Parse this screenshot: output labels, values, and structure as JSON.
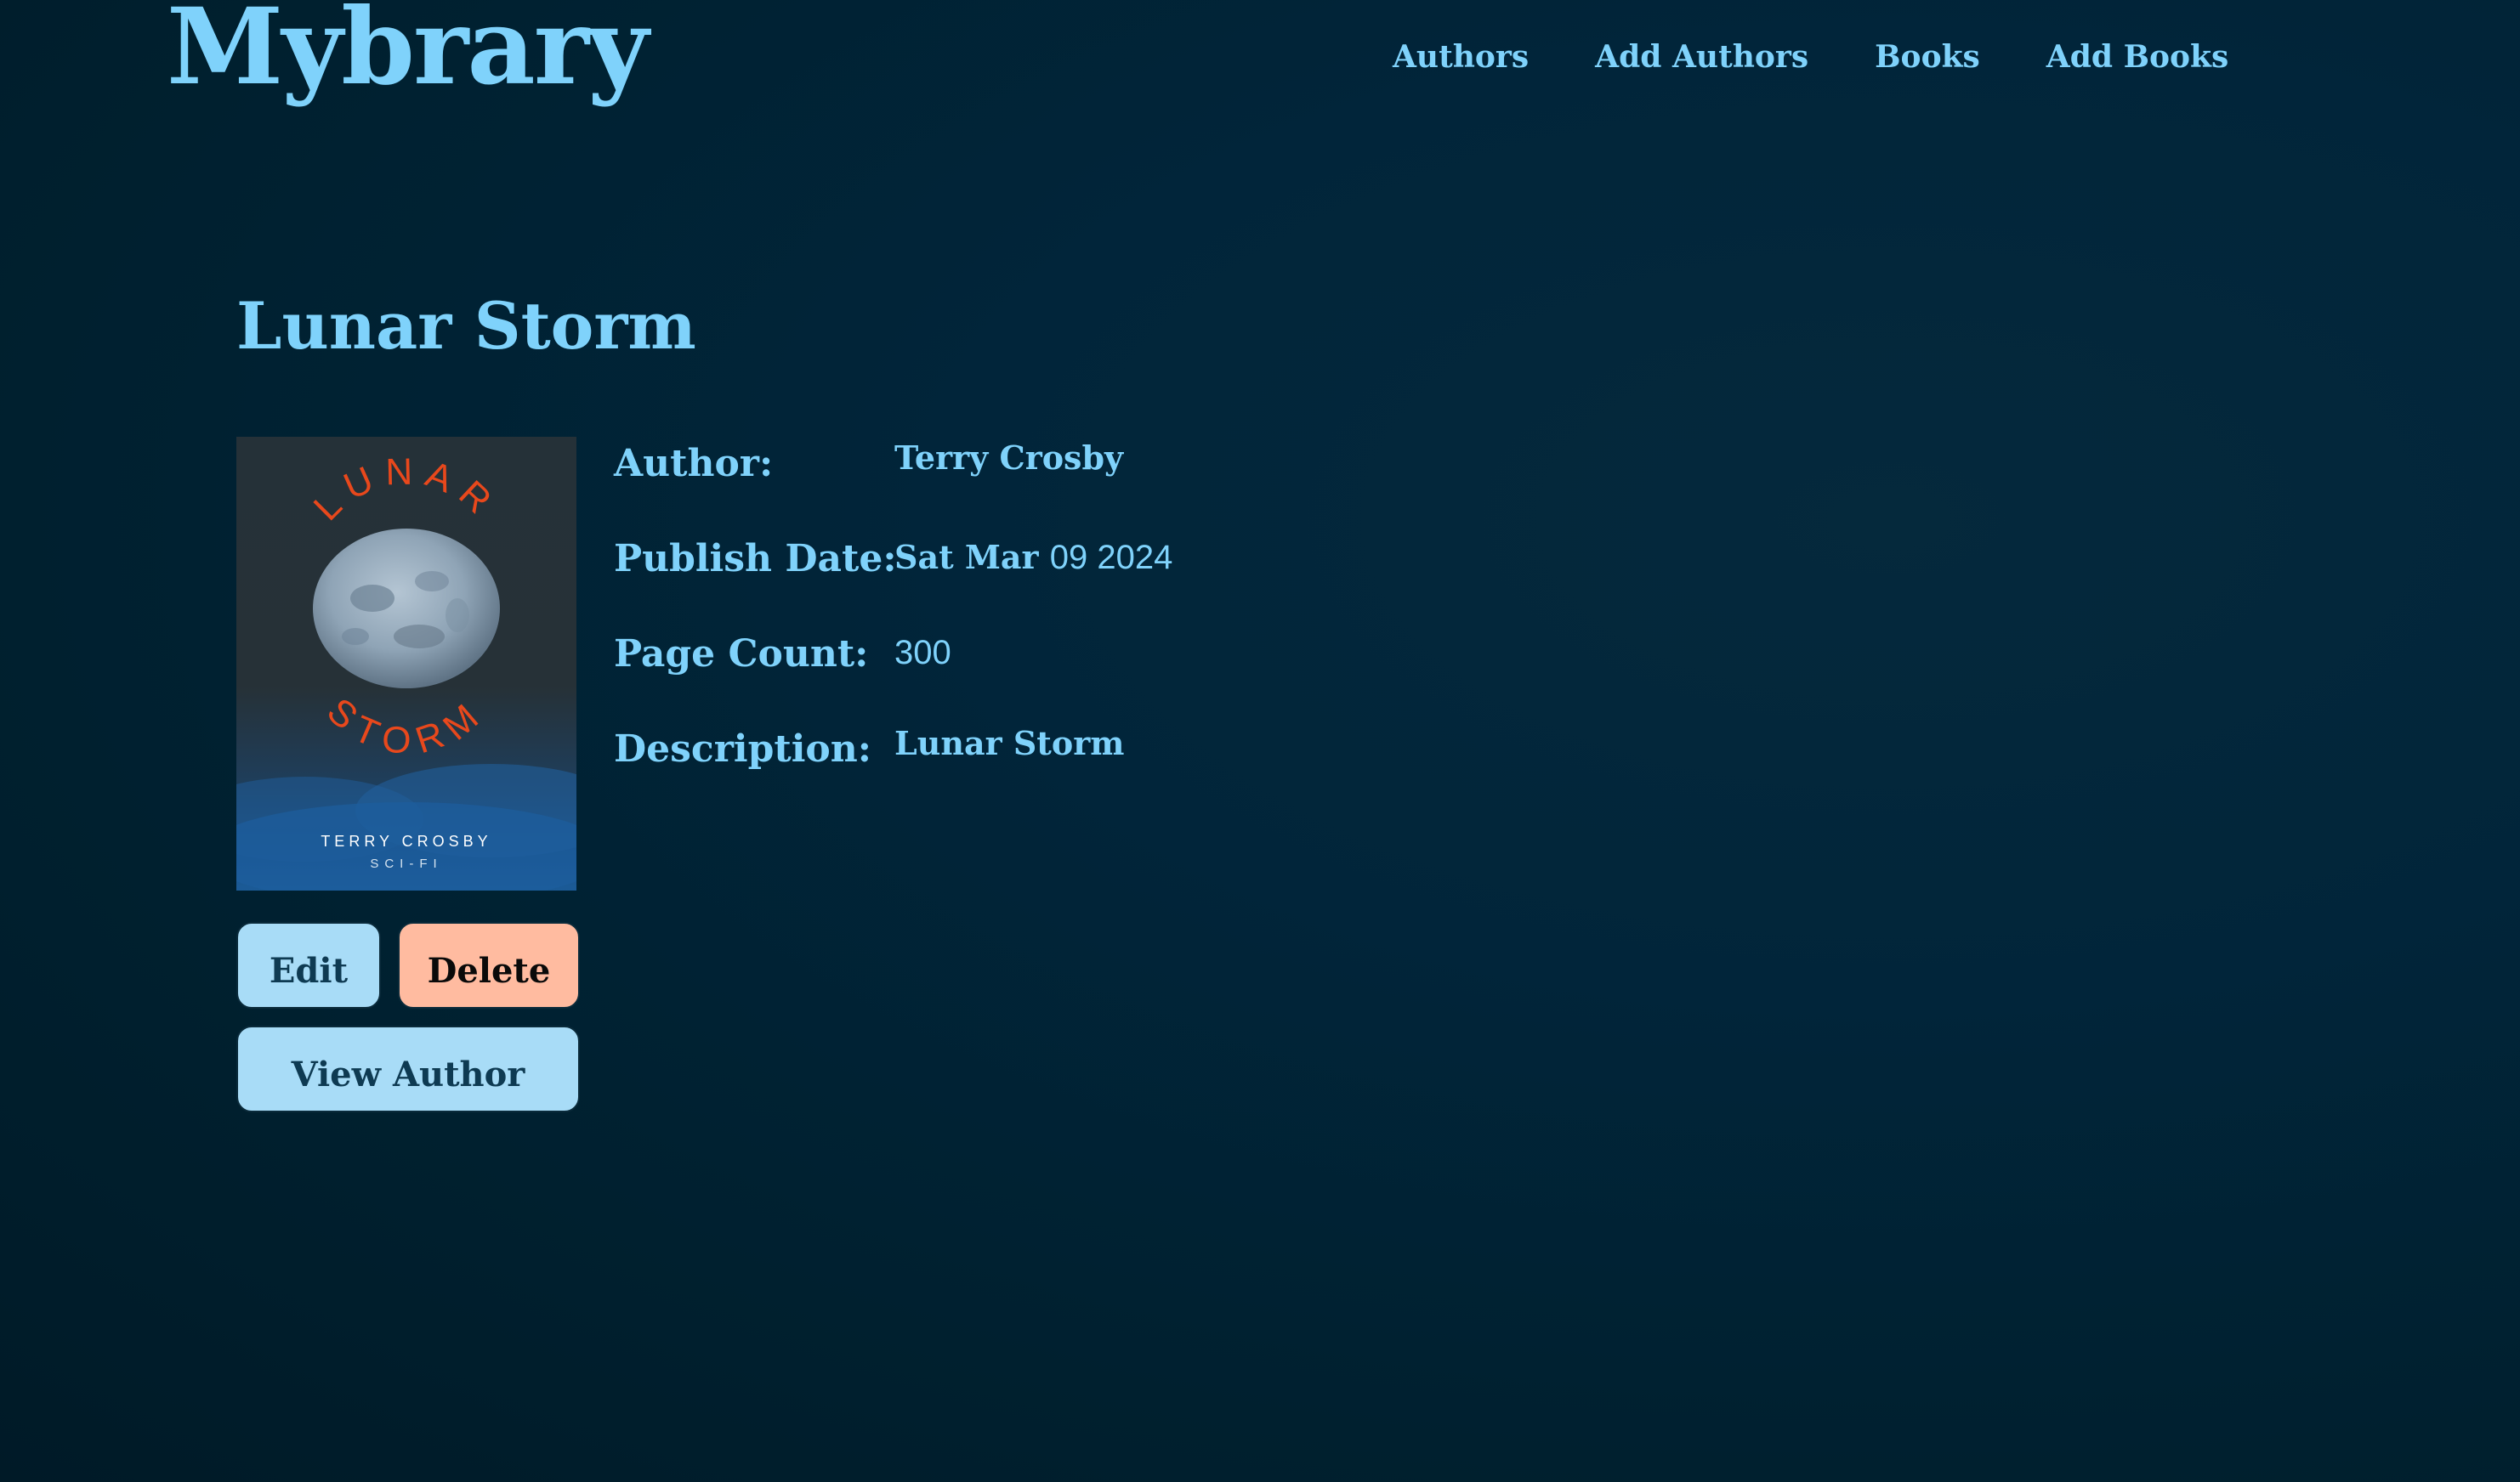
{
  "app": {
    "logo": "Mybrary"
  },
  "nav": {
    "items": [
      {
        "label": "Authors"
      },
      {
        "label": "Add Authors"
      },
      {
        "label": "Books"
      },
      {
        "label": "Add Books"
      }
    ]
  },
  "book": {
    "title": "Lunar Storm",
    "cover": {
      "top_text": "LUNAR",
      "bottom_text": "STORM",
      "author_text": "TERRY CROSBY",
      "genre_text": "SCI-FI",
      "accent_color": "#e8481c"
    },
    "details": [
      {
        "label": "Author:",
        "value": "Terry Crosby"
      },
      {
        "label": "Publish Date:",
        "value_bold": "Sat Mar",
        "value_plain": "09 2024"
      },
      {
        "label": "Page Count:",
        "value_plain": "300"
      },
      {
        "label": "Description:",
        "value": "Lunar Storm"
      }
    ]
  },
  "actions": {
    "edit_label": "Edit",
    "delete_label": "Delete",
    "view_author_label": "View Author"
  },
  "colors": {
    "accent": "#7fd2fb",
    "button_primary": "#a8dcf7",
    "button_danger": "#ffbba0",
    "background": "#01253a"
  }
}
